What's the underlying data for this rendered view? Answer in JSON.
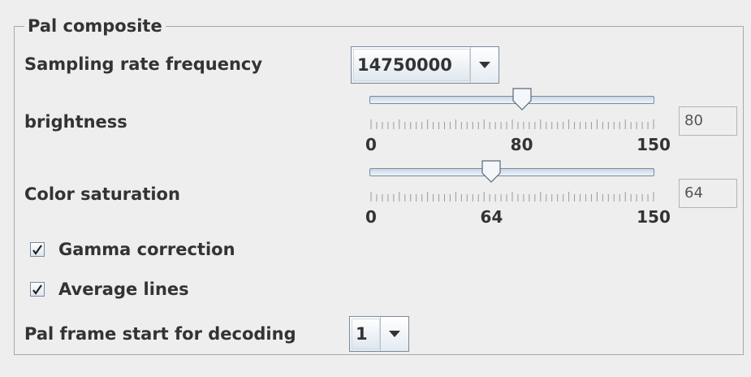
{
  "group": {
    "title": "Pal composite"
  },
  "sampling": {
    "label": "Sampling rate frequency",
    "value": "14750000"
  },
  "brightness": {
    "label": "brightness",
    "min": 0,
    "max": 150,
    "value": 80,
    "min_label": "0",
    "mid_label": "80",
    "max_label": "150",
    "display": "80"
  },
  "saturation": {
    "label": "Color saturation",
    "min": 0,
    "max": 150,
    "value": 64,
    "min_label": "0",
    "mid_label": "64",
    "max_label": "150",
    "display": "64"
  },
  "gamma": {
    "label": "Gamma correction",
    "checked": true
  },
  "average": {
    "label": "Average lines",
    "checked": true
  },
  "frame_start": {
    "label": "Pal frame start for decoding",
    "value": "1"
  },
  "icons": {
    "dropdown": "chevron-down-icon",
    "check": "check-icon",
    "thumb": "slider-thumb"
  }
}
